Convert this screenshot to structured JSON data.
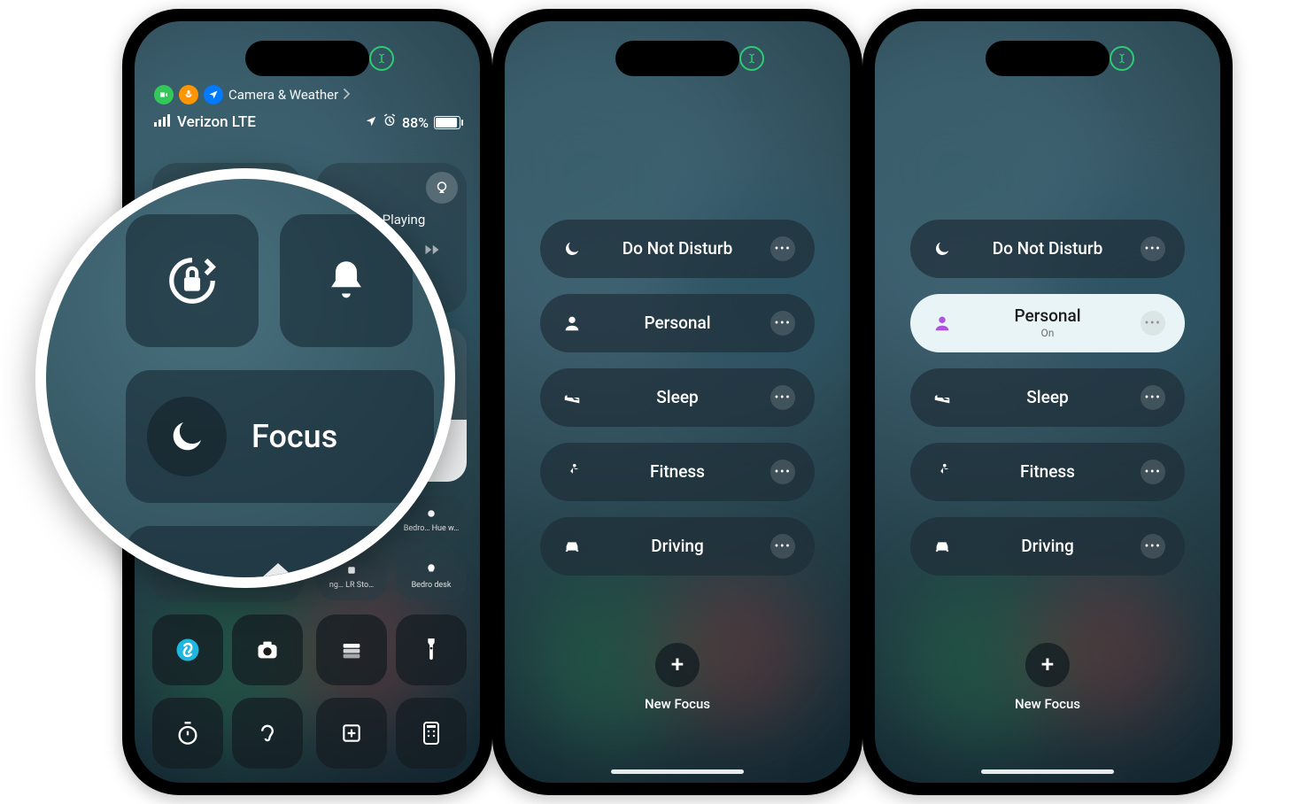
{
  "phone1": {
    "privacy_row": {
      "app_label": "Camera & Weather"
    },
    "status": {
      "carrier": "Verizon LTE",
      "battery_pct": "88%"
    },
    "music": {
      "not_playing": "Not Playing"
    },
    "focus_label": "Focus",
    "home_minis": {
      "m1": "Bedro…",
      "m2": "Bedro… Hue w…",
      "m3": "ng… LR Sto…",
      "m4": "Bedro desk"
    }
  },
  "magnifier": {
    "focus_label": "Focus"
  },
  "focus_modes": {
    "dnd": "Do Not Disturb",
    "personal": "Personal",
    "personal_sub": "On",
    "sleep": "Sleep",
    "fitness": "Fitness",
    "driving": "Driving"
  },
  "new_focus_label": "New Focus"
}
